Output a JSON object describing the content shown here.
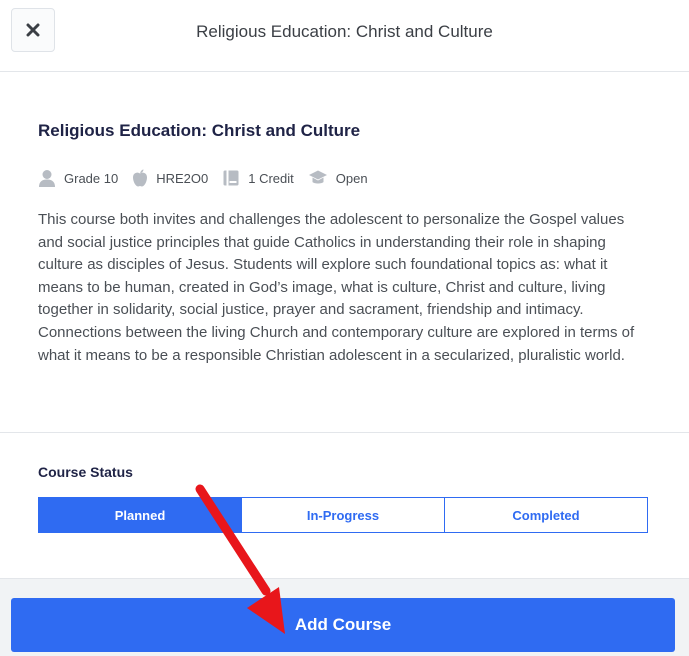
{
  "header": {
    "title": "Religious Education: Christ and Culture",
    "close_icon": "close-icon"
  },
  "course": {
    "title": "Religious Education: Christ and Culture",
    "meta": {
      "grade": "Grade 10",
      "code": "HRE2O0",
      "credit": "1 Credit",
      "pathway": "Open"
    },
    "description": "This course both invites and challenges the adolescent to personalize the Gospel values and social justice principles that guide Catholics in understanding their role in shaping culture as disciples of Jesus. Students will explore such foundational topics as: what it means to be human, created in God’s image, what is culture, Christ and culture, living together in solidarity, social justice, prayer and sacrament, friendship and intimacy. Connections between the living Church and contemporary culture are explored in terms of what it means to be a responsible Christian adolescent in a secularized, pluralistic world."
  },
  "status": {
    "label": "Course Status",
    "options": [
      "Planned",
      "In-Progress",
      "Completed"
    ],
    "selected": "Planned"
  },
  "footer": {
    "add_label": "Add Course"
  },
  "colors": {
    "primary": "#2f6bf2",
    "title": "#1f2346",
    "annotation_arrow": "#e8161b"
  }
}
